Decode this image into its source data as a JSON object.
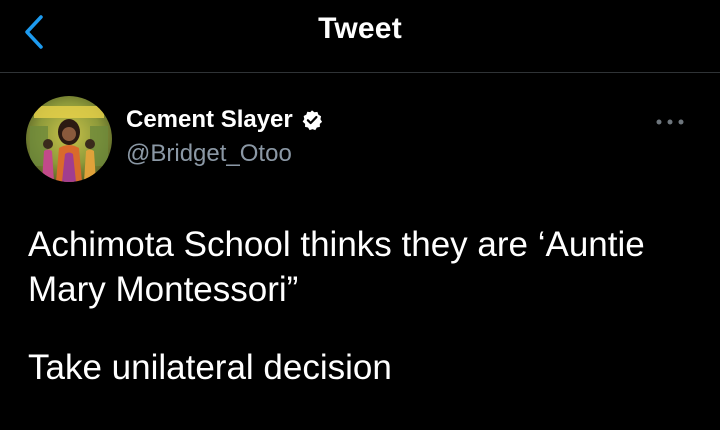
{
  "header": {
    "title": "Tweet",
    "back_icon": "chevron-left-icon",
    "accent_color": "#1d9bf0"
  },
  "tweet": {
    "author": {
      "display_name": "Cement Slayer",
      "handle": "@Bridget_Otoo",
      "verified_icon": "verified-badge-icon"
    },
    "more_icon": "more-horizontal-icon",
    "paragraphs": [
      "Achimota School thinks they are ‘Auntie Mary Montessori”",
      "Take unilateral decision"
    ]
  }
}
